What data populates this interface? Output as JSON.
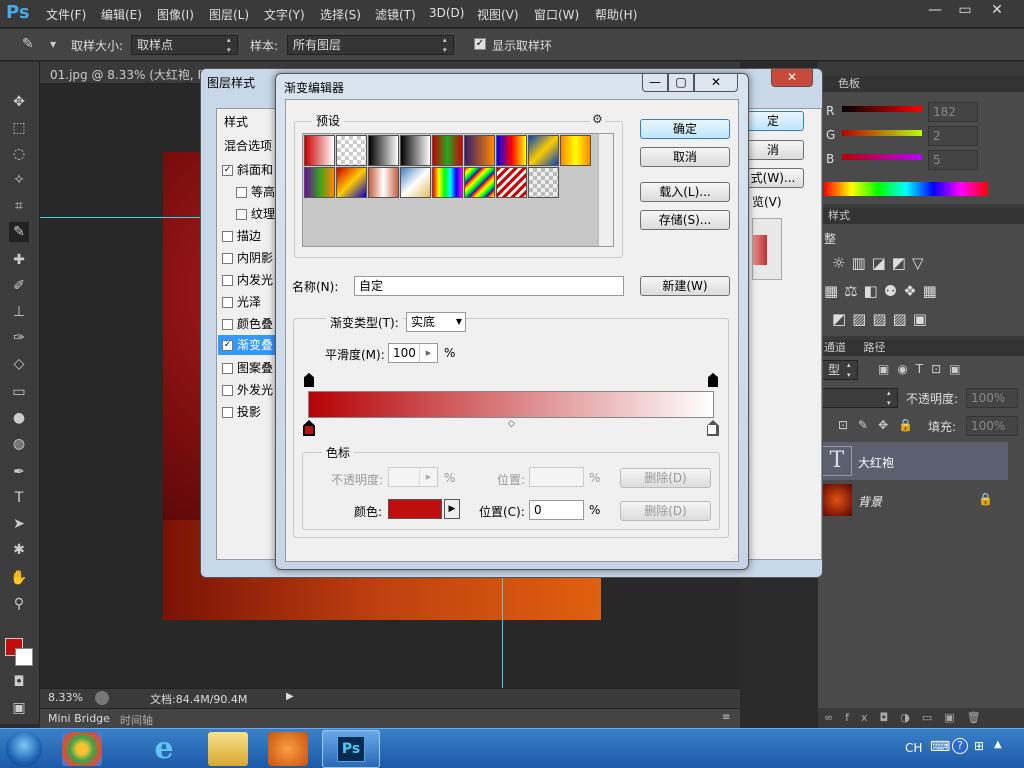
{
  "app": {
    "logo": "Ps",
    "menus": [
      "文件(F)",
      "编辑(E)",
      "图像(I)",
      "图层(L)",
      "文字(Y)",
      "选择(S)",
      "滤镜(T)",
      "3D(D)",
      "视图(V)",
      "窗口(W)",
      "帮助(H)"
    ],
    "window_buttons": [
      "—",
      "▭",
      "✕"
    ]
  },
  "options": {
    "sample_size_label": "取样大小:",
    "sample_size_value": "取样点",
    "sample_label": "样本:",
    "sample_value": "所有图层",
    "show_ring_label": "显示取样环",
    "show_ring_checked": true
  },
  "document": {
    "tab_title": "01.jpg @ 8.33% (大红袍, RG",
    "zoom": "8.33%",
    "doc_info": "文档:84.4M/90.4M",
    "bottom_tabs": [
      "Mini Bridge",
      "时间轴"
    ]
  },
  "layer_style": {
    "title": "图层样式",
    "styles_header": "样式",
    "blend_options": "混合选项",
    "items": [
      {
        "label": "斜面和",
        "checked": true
      },
      {
        "label": "等高",
        "checked": false
      },
      {
        "label": "纹理",
        "checked": false
      },
      {
        "label": "描边",
        "checked": false
      },
      {
        "label": "内阴影",
        "checked": false
      },
      {
        "label": "内发光",
        "checked": false
      },
      {
        "label": "光泽",
        "checked": false
      },
      {
        "label": "颜色叠",
        "checked": false
      },
      {
        "label": "渐变叠",
        "checked": true
      },
      {
        "label": "图案叠",
        "checked": false
      },
      {
        "label": "外发光",
        "checked": false
      },
      {
        "label": "投影",
        "checked": false
      }
    ],
    "right_buttons": [
      "定",
      "消",
      "式(W)..."
    ],
    "preview_label": "览(V)"
  },
  "gradient_editor": {
    "title": "渐变编辑器",
    "presets_label": "预设",
    "ok": "确定",
    "cancel": "取消",
    "load": "载入(L)...",
    "save": "存储(S)...",
    "name_label": "名称(N):",
    "name_value": "自定",
    "new_button": "新建(W)",
    "type_label": "渐变类型(T):",
    "type_value": "实底",
    "smooth_label": "平滑度(M):",
    "smooth_value": "100",
    "percent": "%",
    "stops_label": "色标",
    "opacity_label": "不透明度:",
    "position_label": "位置:",
    "delete_label": "删除(D)",
    "color_label": "颜色:",
    "position_c_label": "位置(C):",
    "position_c_value": "0",
    "stop_color": "#c00d0d"
  },
  "color_panel": {
    "tab": "色板",
    "r_label": "R",
    "r_value": "182",
    "g_label": "G",
    "g_value": "2",
    "b_label": "B",
    "b_value": "5"
  },
  "adjust_panel": {
    "tab": "样式",
    "title": "整"
  },
  "layers_panel": {
    "tabs": [
      "通道",
      "路径"
    ],
    "filter_label": "型",
    "opacity_label": "不透明度:",
    "opacity_value": "100%",
    "fill_label": "填充:",
    "fill_value": "100%",
    "layers": [
      {
        "name": "大红袍",
        "type": "text"
      },
      {
        "name": "背景",
        "type": "image"
      }
    ]
  },
  "taskbar": {
    "lang": "CH",
    "ps_label": "Ps"
  },
  "colors": {
    "foreground": "#c00d0d",
    "background": "#ffffff",
    "gradient_start": "#b60205",
    "gradient_end": "#ffffff"
  }
}
